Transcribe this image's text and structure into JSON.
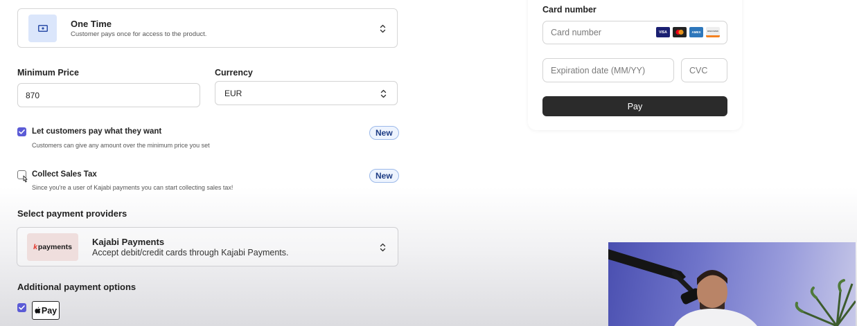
{
  "pricing_type": {
    "title": "One Time",
    "description": "Customer pays once for access to the product."
  },
  "price": {
    "label": "Minimum Price",
    "value": "870"
  },
  "currency": {
    "label": "Currency",
    "value": "EUR"
  },
  "options": [
    {
      "label": "Let customers pay what they want",
      "description": "Customers can give any amount over the minimum price you set",
      "checked": true,
      "badge": "New"
    },
    {
      "label": "Collect Sales Tax",
      "description": "Since you're a user of Kajabi payments you can start collecting sales tax!",
      "checked": false,
      "badge": "New"
    }
  ],
  "providers": {
    "section_title": "Select payment providers",
    "selected": {
      "logo_mark": "k",
      "logo_text": "payments",
      "name": "Kajabi Payments",
      "description": "Accept debit/credit cards through Kajabi Payments."
    }
  },
  "additional": {
    "section_title": "Additional payment options",
    "apple_pay_text": "Pay",
    "apple_pay_checked": true
  },
  "checkout_preview": {
    "card_label": "Card number",
    "card_placeholder": "Card number",
    "brands": [
      {
        "name": "visa-icon",
        "text": "VISA",
        "color": "#1a1f71"
      },
      {
        "name": "mastercard-icon",
        "text": "",
        "color": "#222222"
      },
      {
        "name": "amex-icon",
        "text": "AMEX",
        "color": "#2e77bb"
      },
      {
        "name": "discover-icon",
        "text": "DISCOVER",
        "color": "#eeeeee"
      }
    ],
    "expiry_placeholder": "Expiration date (MM/YY)",
    "cvc_placeholder": "CVC",
    "pay_label": "Pay"
  },
  "colors": {
    "accent": "#5b5bd6",
    "badge_bg": "#eef4fe",
    "badge_text": "#1d3c84",
    "pay_button": "#2b2b2b"
  }
}
